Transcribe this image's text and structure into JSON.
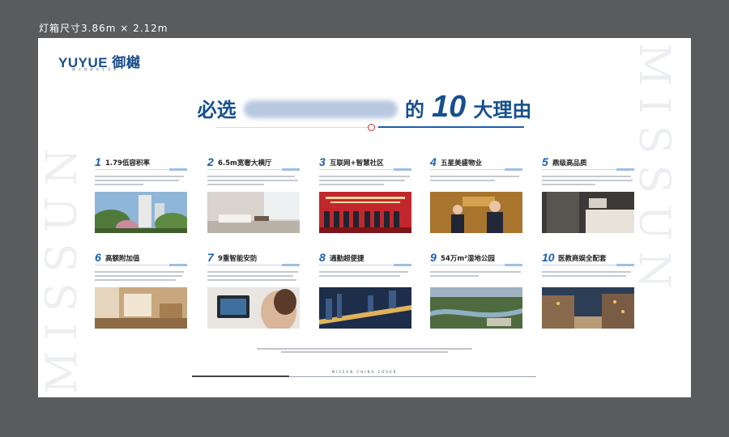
{
  "topbar": {
    "label": "灯箱尺寸3.86m × 2.12m"
  },
  "board": {
    "side_text": "MISSUN",
    "logo": "YUYUE 御樾",
    "logo_sub": "御 沙 地 豪 宅 生 活 家",
    "title": {
      "pre": "必选",
      "mid": "的",
      "num": "10",
      "post": "大理由"
    },
    "footer_brand": "MISSUN CHINA COVER",
    "items": [
      {
        "num": "1",
        "title": "1.79低容积率"
      },
      {
        "num": "2",
        "title": "6.5m宽奢大横厅"
      },
      {
        "num": "3",
        "title": "互联网+智慧社区"
      },
      {
        "num": "4",
        "title": "五星美盛物业"
      },
      {
        "num": "5",
        "title": "鼎级高品质"
      },
      {
        "num": "6",
        "title": "高额附加值"
      },
      {
        "num": "7",
        "title": "9重智能安防"
      },
      {
        "num": "8",
        "title": "通勤超便捷"
      },
      {
        "num": "9",
        "title": "54万m²湿地公园"
      },
      {
        "num": "10",
        "title": "医教商娱全配套"
      }
    ]
  }
}
